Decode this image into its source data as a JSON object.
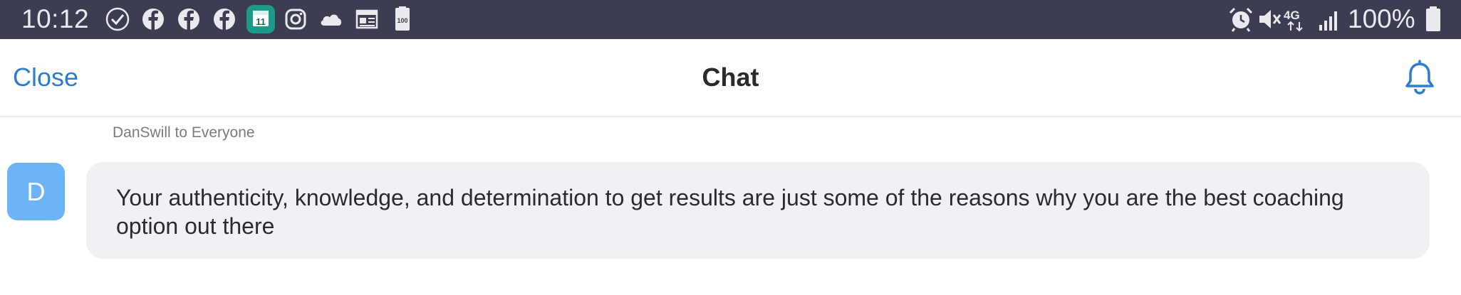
{
  "status_bar": {
    "time": "10:12",
    "battery_percent": "100%",
    "calendar_badge": "11",
    "storage_badge": "100",
    "network_label": "4G",
    "left_icons": [
      "check-circle-icon",
      "facebook-icon",
      "facebook-icon",
      "facebook-icon",
      "calendar-icon",
      "instagram-icon",
      "cloud-icon",
      "news-icon",
      "storage-icon"
    ],
    "right_icons": [
      "alarm-icon",
      "mute-icon",
      "network-4g-icon",
      "signal-icon",
      "battery-icon"
    ]
  },
  "header": {
    "close_label": "Close",
    "title": "Chat",
    "bell_icon": "bell-icon"
  },
  "message": {
    "sender_line": "DanSwill to Everyone",
    "avatar_initial": "D",
    "text": "Your authenticity, knowledge, and determination to get results are just some of the reasons why you are the best coaching option out there"
  },
  "colors": {
    "status_bar_bg": "#3c3d52",
    "accent": "#2b7cd3",
    "avatar_bg": "#6cb4f7",
    "bubble_bg": "#f0f0f5"
  }
}
